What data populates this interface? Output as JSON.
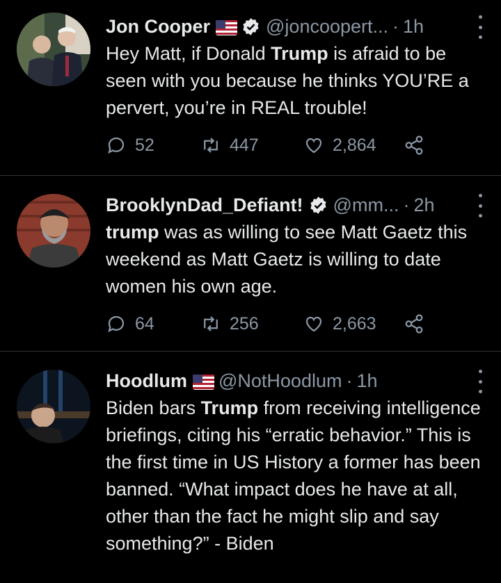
{
  "tweets": [
    {
      "name": "Jon Cooper",
      "has_flag": true,
      "verified": true,
      "handle": "@joncoopert...",
      "dot": "·",
      "time": "1h",
      "text_parts": [
        {
          "t": "Hey Matt, if Donald ",
          "bold": false
        },
        {
          "t": "Trump",
          "bold": true
        },
        {
          "t": " is afraid to be seen with you because he thinks YOU’RE a pervert, you’re in REAL trouble!",
          "bold": false
        }
      ],
      "replies": "52",
      "retweets": "447",
      "likes": "2,864"
    },
    {
      "name": "BrooklynDad_Defiant!",
      "has_flag": false,
      "verified": true,
      "handle": "@mm...",
      "dot": "·",
      "time": "2h",
      "text_parts": [
        {
          "t": "trump",
          "bold": true
        },
        {
          "t": " was as willing to see Matt Gaetz this weekend as Matt Gaetz is willing to date women his own age.",
          "bold": false
        }
      ],
      "replies": "64",
      "retweets": "256",
      "likes": "2,663"
    },
    {
      "name": "Hoodlum",
      "has_flag": true,
      "verified": false,
      "handle": "@NotHoodlum",
      "dot": "·",
      "time": "1h",
      "text_parts": [
        {
          "t": "Biden bars ",
          "bold": false
        },
        {
          "t": "Trump",
          "bold": true
        },
        {
          "t": " from receiving intelligence briefings, citing his “erratic behavior.” This is the first time in US History a former has been banned. “What impact does he have at all, other than the fact he might slip and say something?” - Biden",
          "bold": false
        }
      ]
    }
  ],
  "colors": {
    "background": "#000000",
    "text": "#e7e9ea",
    "secondary": "#8b98a5",
    "divider": "#2f3336"
  },
  "icons": [
    "reply-icon",
    "retweet-icon",
    "like-icon",
    "share-icon",
    "verified-badge-icon",
    "us-flag-icon",
    "more-options-icon"
  ]
}
